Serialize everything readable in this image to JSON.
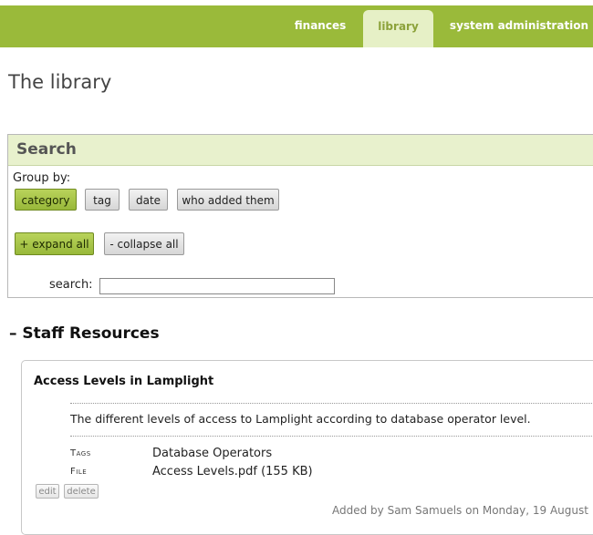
{
  "nav": {
    "tabs": [
      {
        "label": "finances",
        "active": false
      },
      {
        "label": "library",
        "active": true
      },
      {
        "label": "system administration",
        "active": false
      }
    ]
  },
  "page": {
    "title": "The library"
  },
  "search": {
    "heading": "Search",
    "group_by_label": "Group by:",
    "group_buttons": [
      {
        "label": "category",
        "active": true
      },
      {
        "label": "tag",
        "active": false
      },
      {
        "label": "date",
        "active": false
      },
      {
        "label": "who added them",
        "active": false
      }
    ],
    "expand_all_label": "+ expand all",
    "collapse_all_label": "- collapse all",
    "search_label": "search:",
    "search_value": ""
  },
  "section": {
    "title": "– Staff Resources"
  },
  "resource": {
    "title": "Access Levels in Lamplight",
    "description": "The different levels of access to Lamplight according to database operator level.",
    "tags_label": "Tags",
    "tags_value": "Database Operators",
    "file_label": "File",
    "file_value": "Access Levels.pdf (155 KB)",
    "edit_label": "edit",
    "delete_label": "delete",
    "added_by": "Added by Sam Samuels on Monday, 19 August"
  },
  "colors": {
    "nav_bar": "#9aba3a",
    "active_tab_bg": "#e6f0c6",
    "search_header_bg": "#e8f1cd",
    "active_button": "#a8c64a"
  }
}
